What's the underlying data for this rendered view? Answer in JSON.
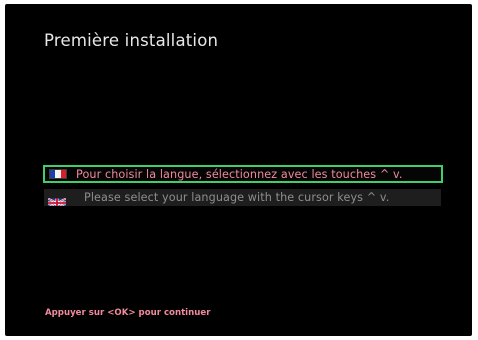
{
  "screen": {
    "title": "Première installation"
  },
  "languages": [
    {
      "flag": "france-flag-icon",
      "label": "Pour choisir la langue, sélectionnez avec les touches ^  v.",
      "selected": true
    },
    {
      "flag": "uk-flag-icon",
      "label": "Please select your language with the cursor keys ^  v.",
      "selected": false
    }
  ],
  "footer": {
    "hint": "Appuyer sur <OK> pour continuer"
  },
  "colors": {
    "background": "#000000",
    "selection_border": "#3fcf6a",
    "accent_text": "#f08a9c",
    "inactive_text": "#8e8e8e",
    "inactive_row": "#1e1e1e"
  }
}
